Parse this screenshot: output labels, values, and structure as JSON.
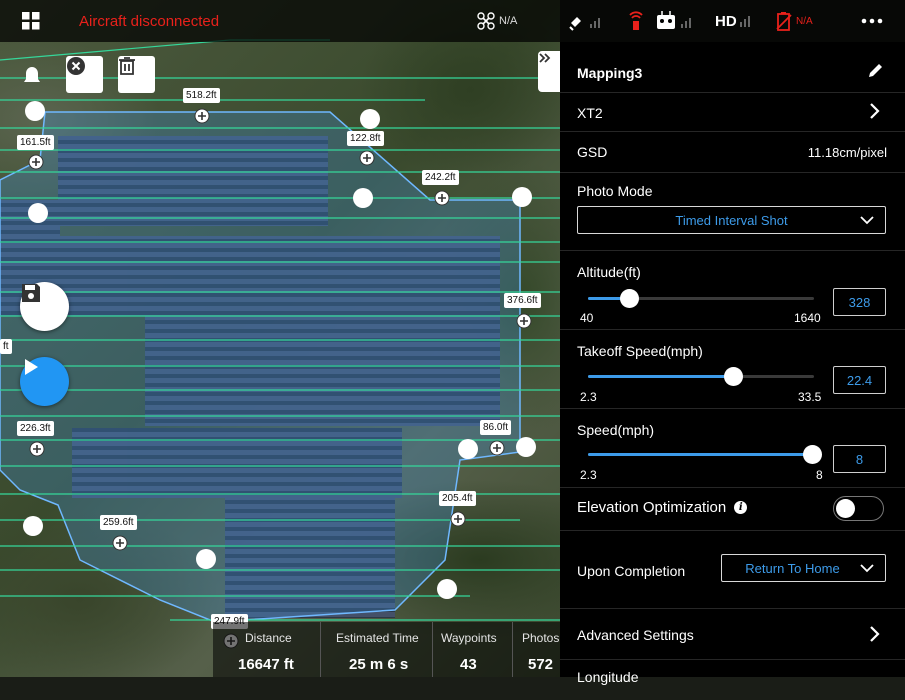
{
  "topbar": {
    "status": "Aircraft disconnected",
    "drone_signal": "N/A",
    "hd_label": "HD",
    "battery_value": "N/A"
  },
  "map": {
    "distance_labels": [
      "518.2ft",
      "161.5ft",
      "122.8ft",
      "242.2ft",
      "376.6ft",
      "ft",
      "226.3ft",
      "86.0ft",
      "205.4ft",
      "259.6ft",
      "247.9ft"
    ]
  },
  "stats": {
    "distance": {
      "label": "Distance",
      "value": "16647 ft"
    },
    "time": {
      "label": "Estimated Time",
      "value": "25 m 6 s"
    },
    "waypoints": {
      "label": "Waypoints",
      "value": "43"
    },
    "photos": {
      "label": "Photos",
      "value": "572"
    }
  },
  "panel": {
    "mission_name": "Mapping3",
    "camera": "XT2",
    "gsd_label": "GSD",
    "gsd_value": "11.18cm/pixel",
    "photo_mode_label": "Photo Mode",
    "photo_mode_value": "Timed Interval Shot",
    "altitude": {
      "label": "Altitude(ft)",
      "min": "40",
      "max": "1640",
      "value": "328",
      "fraction": 0.18
    },
    "takeoff_speed": {
      "label": "Takeoff Speed(mph)",
      "min": "2.3",
      "max": "33.5",
      "value": "22.4",
      "fraction": 0.64
    },
    "speed": {
      "label": "Speed(mph)",
      "min": "2.3",
      "max": "8",
      "value": "8",
      "fraction": 1.0
    },
    "elevation_label": "Elevation Optimization",
    "elevation_on": false,
    "completion_label": "Upon Completion",
    "completion_value": "Return To Home",
    "advanced_label": "Advanced Settings",
    "longitude_label": "Longitude"
  },
  "colors": {
    "accent": "#3d9be9",
    "alert": "#e8211b",
    "route": "#35d79a"
  },
  "icons": [
    "grid-icon",
    "drone-icon",
    "satellite-icon",
    "remote-signal-icon",
    "controller-icon",
    "hd-signal-icon",
    "battery-icon",
    "more-icon",
    "bell-icon",
    "close-circle-icon",
    "trash-icon",
    "chevron-double-right-icon",
    "save-icon",
    "play-icon",
    "pencil-icon",
    "chevron-right-icon",
    "chevron-down-icon",
    "info-icon"
  ]
}
